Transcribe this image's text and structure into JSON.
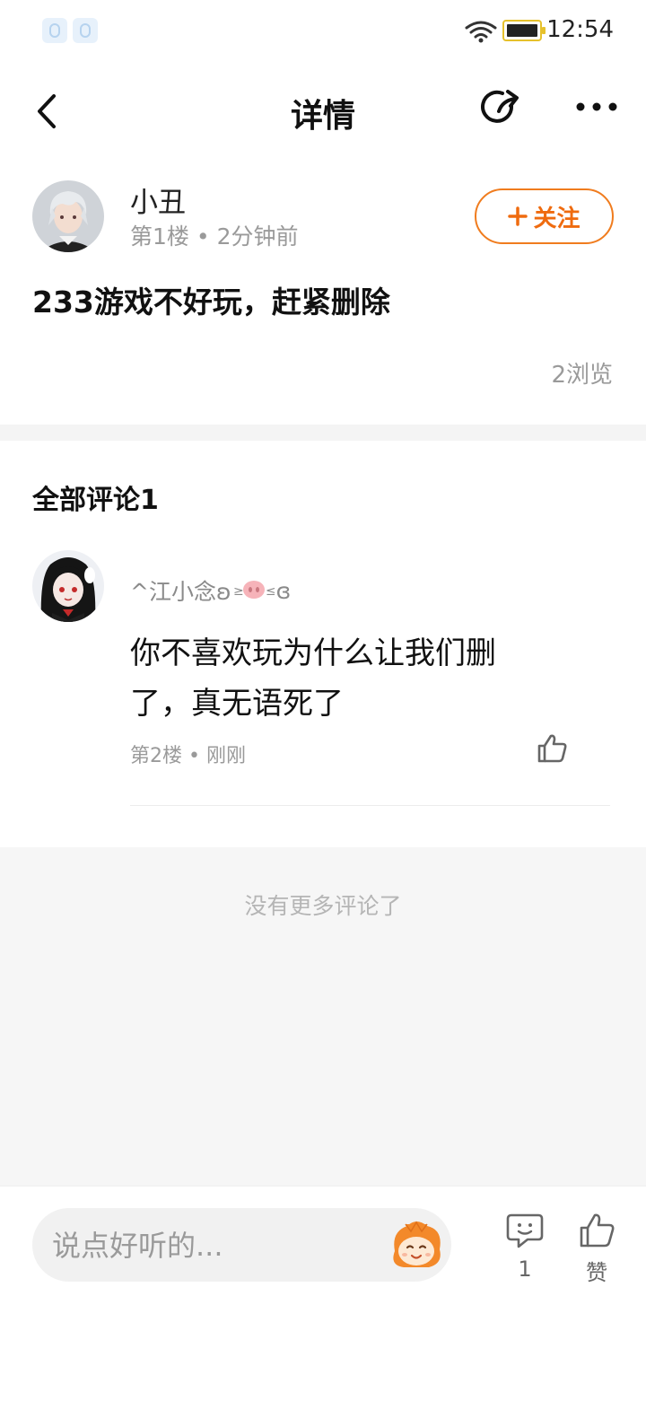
{
  "status_bar": {
    "time": "12:54"
  },
  "header": {
    "title": "详情"
  },
  "post": {
    "author": "小丑",
    "floor": "第1楼",
    "time": "2分钟前",
    "follow_label": "关注",
    "content": "233游戏不好玩，赶紧删除",
    "views": "2浏览"
  },
  "comments_section": {
    "title": "全部评论1",
    "comments": [
      {
        "author_prefix": "^江小念ʚ",
        "author_suffix": "ɞ",
        "text_line1": "你不喜欢玩为什么让我们删",
        "text_line2": "了，真无语死了",
        "floor": "第2楼",
        "time": "刚刚"
      }
    ],
    "no_more_text": "没有更多评论了"
  },
  "bottom_bar": {
    "input_placeholder": "说点好听的...",
    "comment_count": "1",
    "like_label": "赞"
  },
  "colors": {
    "accent_orange": "#ef6b0f",
    "battery_yellow": "#e6c12c"
  },
  "icons": [
    "back-arrow-icon",
    "share-icon",
    "more-icon",
    "plus-icon",
    "thumbs-up-icon",
    "comment-bubble-icon",
    "wifi-icon",
    "battery-icon",
    "emoji-mascot-icon"
  ]
}
